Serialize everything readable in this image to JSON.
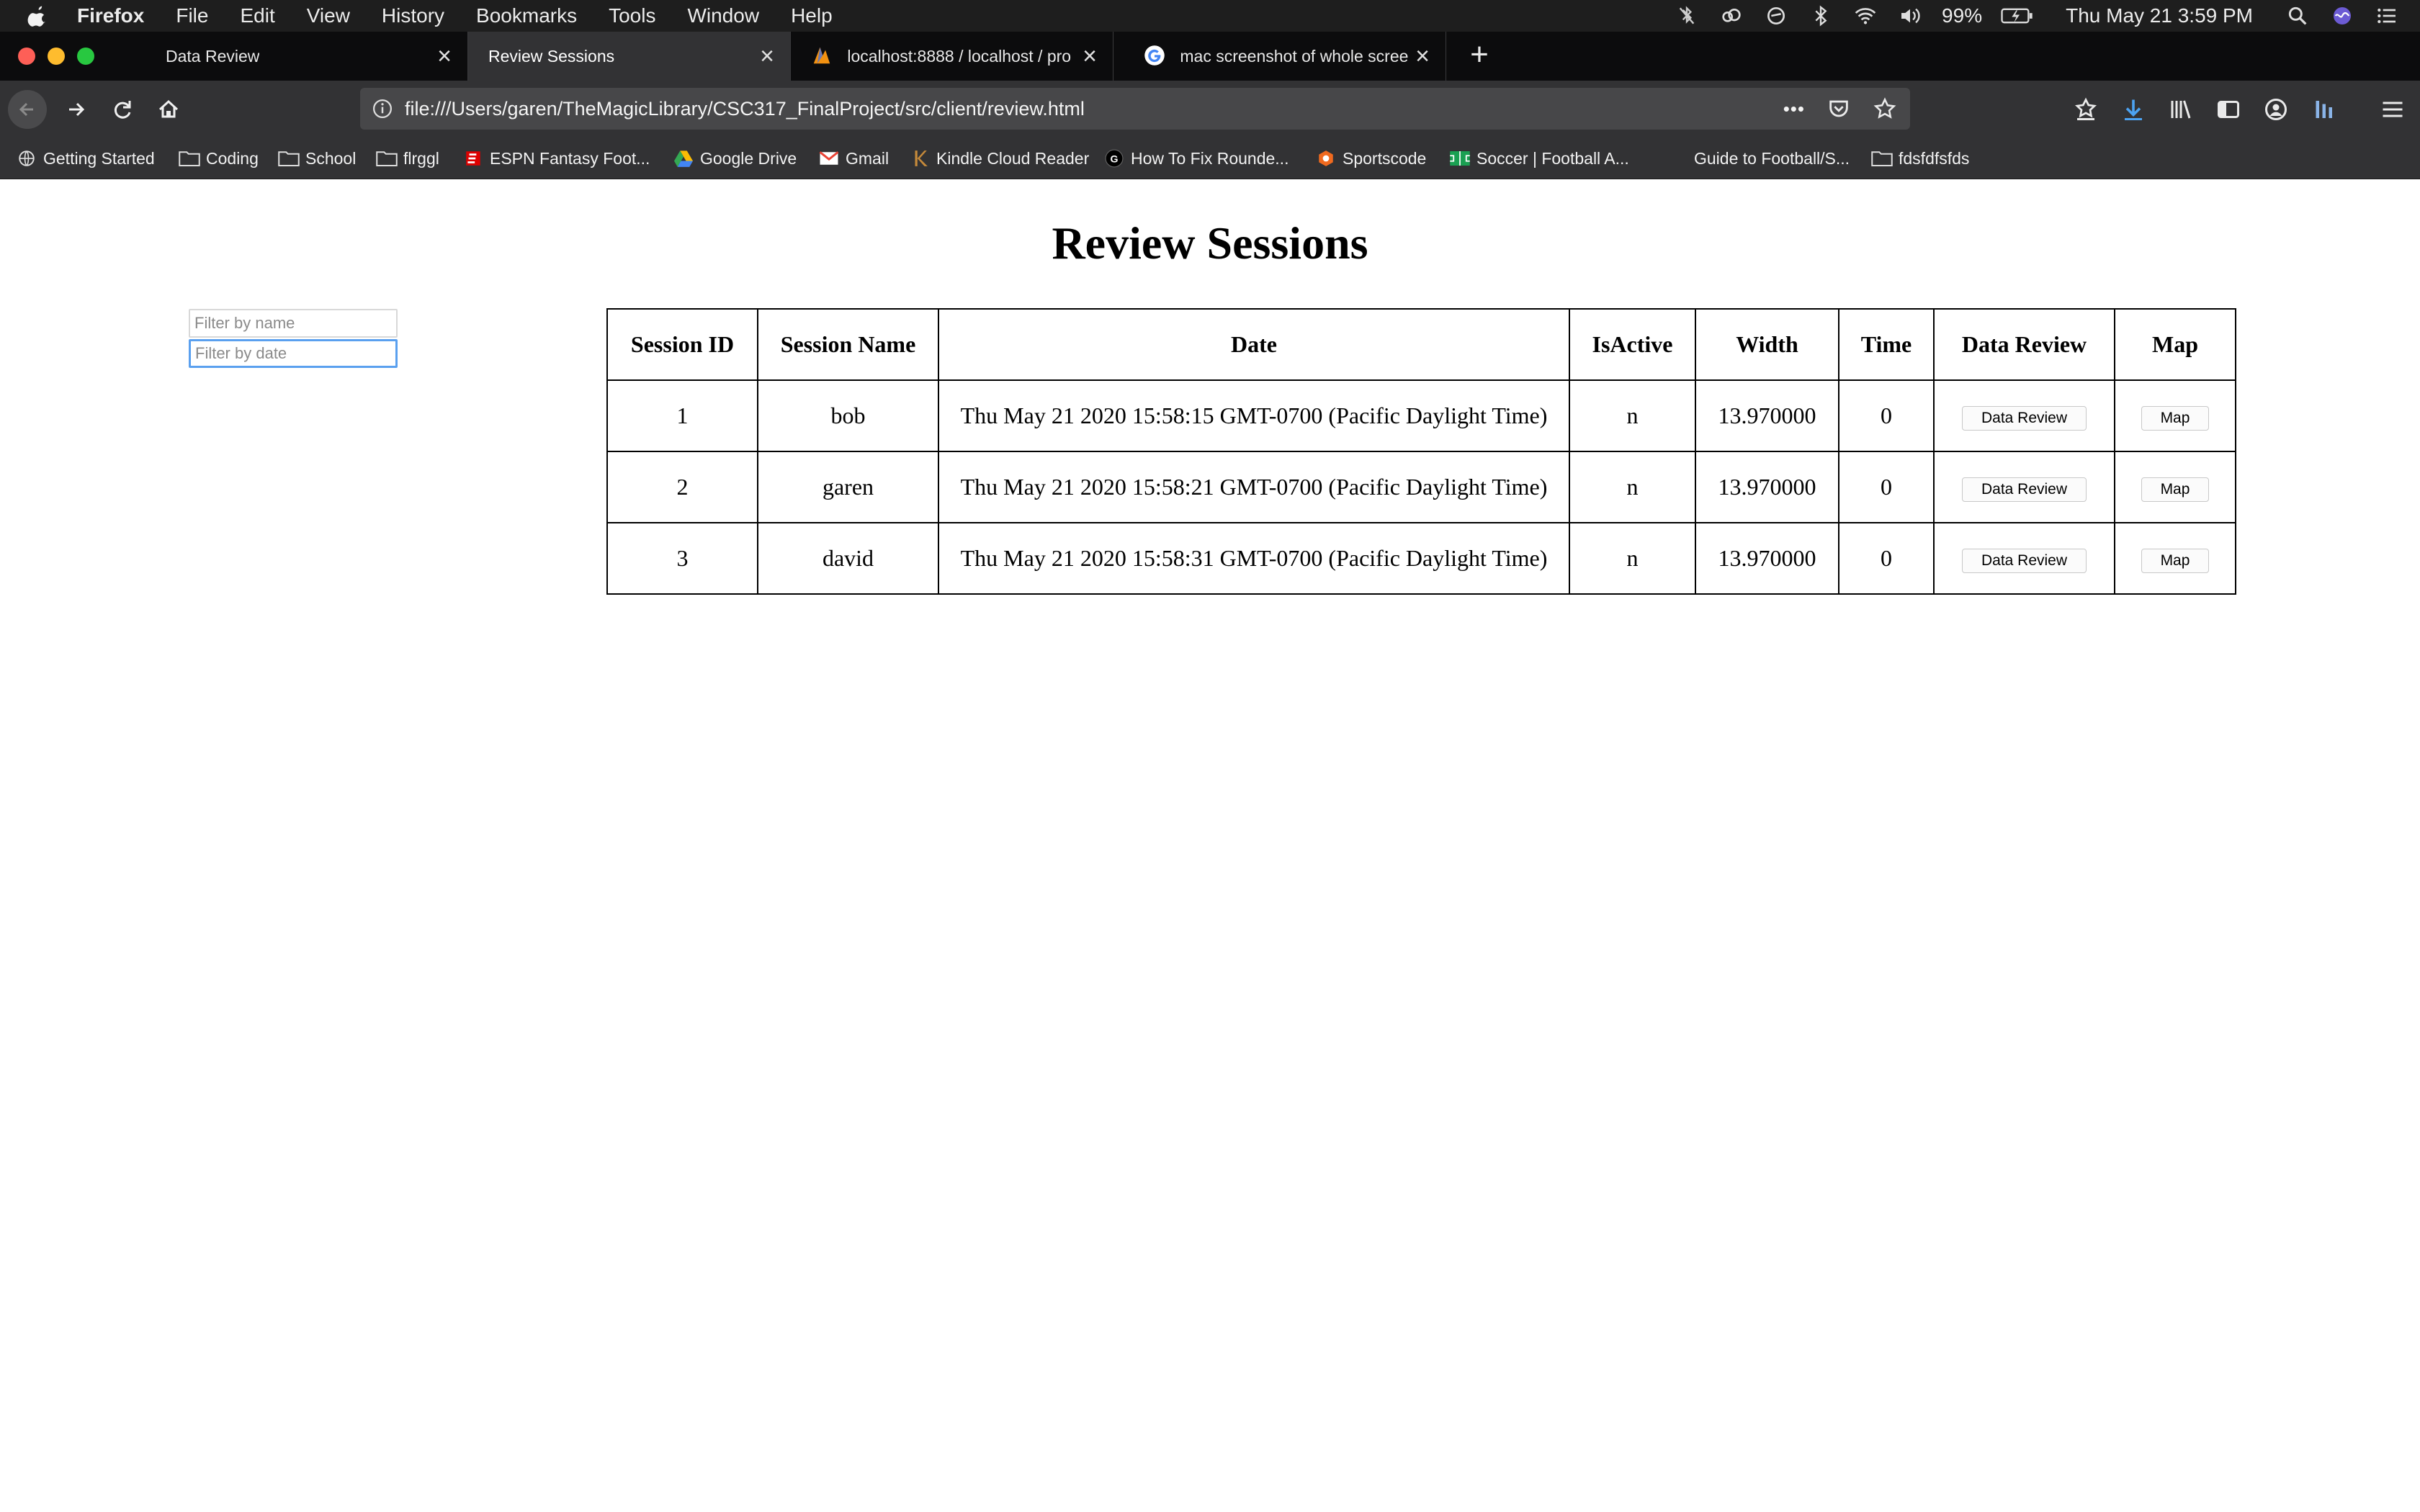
{
  "menubar": {
    "menus": [
      "Firefox",
      "File",
      "Edit",
      "View",
      "History",
      "Bookmarks",
      "Tools",
      "Window",
      "Help"
    ],
    "battery": "99%",
    "clock": "Thu May 21  3:59 PM",
    "status_icons": [
      "bluetooth-off-icon",
      "creative-cloud-icon",
      "sync-icon",
      "bluetooth-icon",
      "wifi-icon",
      "volume-icon",
      "battery-icon",
      "spotlight-icon",
      "siri-icon",
      "notification-center-icon"
    ]
  },
  "tabs": [
    {
      "label": "Data Review",
      "active": false
    },
    {
      "label": "Review Sessions",
      "active": true
    },
    {
      "label": "localhost:8888 / localhost / pro",
      "active": false
    },
    {
      "label": "mac screenshot of whole scree",
      "active": false
    }
  ],
  "navbar": {
    "url": "file:///Users/garen/TheMagicLibrary/CSC317_FinalProject/src/client/review.html",
    "url_more": "•••"
  },
  "bookmarks": [
    "Getting Started",
    "Coding",
    "School",
    "flrggl",
    "ESPN Fantasy Foot...",
    "Google Drive",
    "Gmail",
    "Kindle Cloud Reader",
    "How To Fix Rounde...",
    "Sportscode",
    "Soccer | Football A...",
    "Guide to Football/S...",
    "fdsfdfsfds"
  ],
  "page": {
    "title": "Review Sessions",
    "filter_name_placeholder": "Filter by name",
    "filter_date_placeholder": "Filter by date",
    "table": {
      "headers": [
        "Session ID",
        "Session Name",
        "Date",
        "IsActive",
        "Width",
        "Time",
        "Data Review",
        "Map"
      ],
      "rows": [
        {
          "id": "1",
          "name": "bob",
          "date": "Thu May 21 2020 15:58:15 GMT-0700 (Pacific Daylight Time)",
          "active": "n",
          "width": "13.970000",
          "time": "0"
        },
        {
          "id": "2",
          "name": "garen",
          "date": "Thu May 21 2020 15:58:21 GMT-0700 (Pacific Daylight Time)",
          "active": "n",
          "width": "13.970000",
          "time": "0"
        },
        {
          "id": "3",
          "name": "david",
          "date": "Thu May 21 2020 15:58:31 GMT-0700 (Pacific Daylight Time)",
          "active": "n",
          "width": "13.970000",
          "time": "0"
        }
      ],
      "data_review_button": "Data Review",
      "map_button": "Map"
    }
  }
}
